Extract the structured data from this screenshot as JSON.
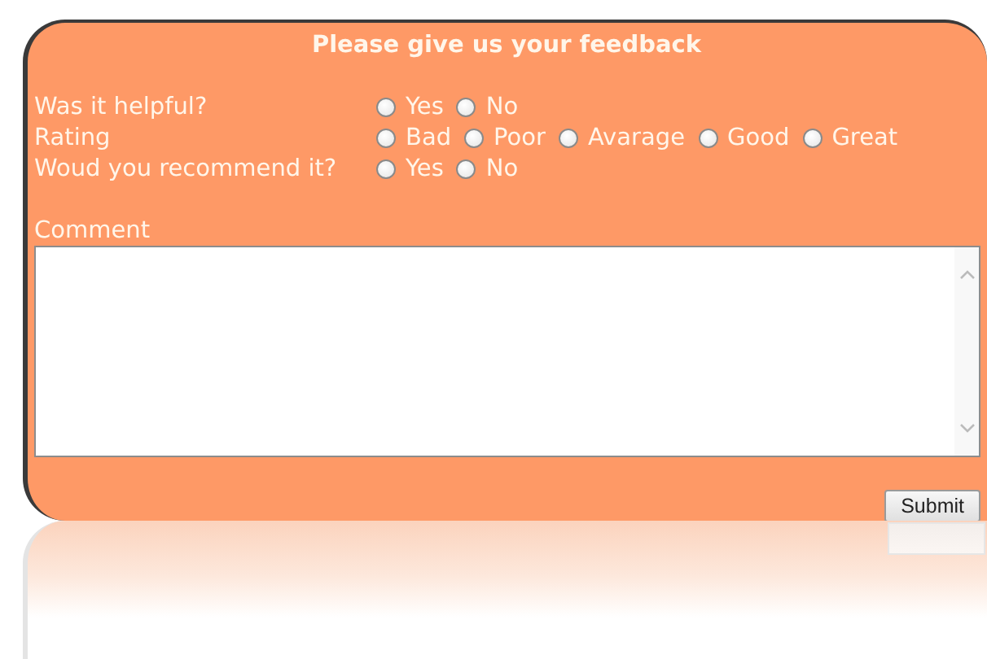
{
  "title": "Please give us your feedback",
  "questions": [
    {
      "label": "Was it helpful?",
      "options": [
        {
          "label": "Yes",
          "selected": false
        },
        {
          "label": "No",
          "selected": false
        }
      ]
    },
    {
      "label": "Rating",
      "options": [
        {
          "label": "Bad",
          "selected": false
        },
        {
          "label": "Poor",
          "selected": false
        },
        {
          "label": "Avarage",
          "selected": false
        },
        {
          "label": "Good",
          "selected": false
        },
        {
          "label": "Great",
          "selected": false
        }
      ]
    },
    {
      "label": "Woud you recommend it?",
      "options": [
        {
          "label": "Yes",
          "selected": false
        },
        {
          "label": "No",
          "selected": false
        }
      ]
    }
  ],
  "comment": {
    "label": "Comment"
  },
  "submit_button": "Submit"
}
